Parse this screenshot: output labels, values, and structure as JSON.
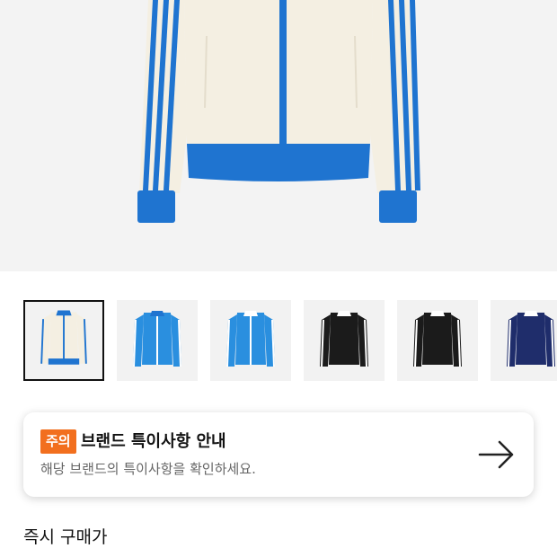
{
  "product": {
    "image_alt": "track jacket"
  },
  "thumbnails": [
    {
      "name": "white-blue",
      "colors": {
        "body": "#f4efe2",
        "accent": "#1f74d0",
        "trim": "#1f74d0"
      }
    },
    {
      "name": "blue",
      "colors": {
        "body": "#2a8fdf",
        "accent": "#ffffff",
        "trim": "#1f74d0"
      }
    },
    {
      "name": "blue-2",
      "colors": {
        "body": "#2a8fdf",
        "accent": "#ffffff",
        "trim": "#1f74d0"
      }
    },
    {
      "name": "black",
      "colors": {
        "body": "#1b1b1b",
        "accent": "#ffffff",
        "trim": "#1b1b1b"
      }
    },
    {
      "name": "black-2",
      "colors": {
        "body": "#1b1b1b",
        "accent": "#ffffff",
        "trim": "#1b1b1b"
      }
    },
    {
      "name": "navy",
      "colors": {
        "body": "#1f2d6b",
        "accent": "#ffffff",
        "trim": "#1f2d6b"
      }
    }
  ],
  "notice": {
    "badge": "주의",
    "title": "브랜드 특이사항 안내",
    "description": "해당 브랜드의 특이사항을 확인하세요.",
    "arrow_icon": "arrow-right-icon"
  },
  "price": {
    "label": "즉시 구매가"
  },
  "colors": {
    "accent_orange": "#f26f1e",
    "adidas_blue": "#1f74d0"
  }
}
